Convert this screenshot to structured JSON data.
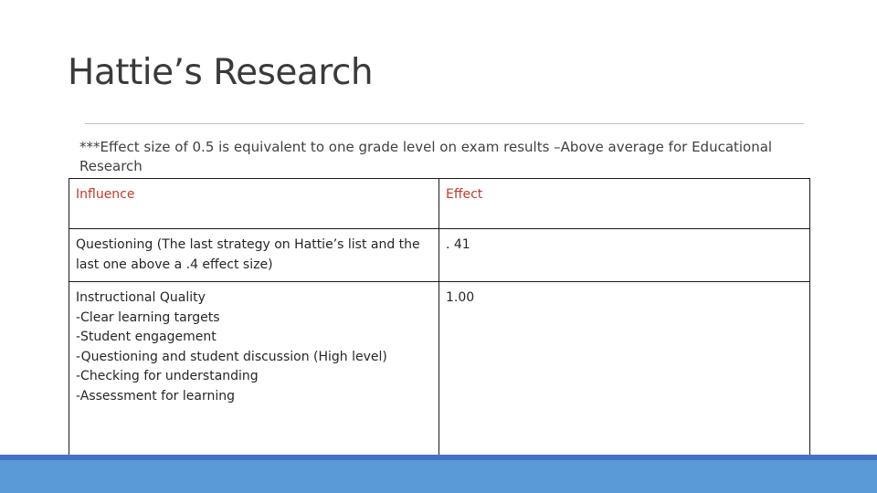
{
  "slide": {
    "title": "Hattie’s Research",
    "note": "***Effect size of 0.5 is equivalent to one grade level on exam results –Above average for Educational Research"
  },
  "table": {
    "headers": [
      "Influence",
      "Effect"
    ],
    "rows": [
      {
        "influence": "Questioning (The last strategy on Hattie’s list and the last one above a .4 effect size)",
        "effect": ". 41"
      },
      {
        "influence": "Instructional Quality\n-Clear learning targets\n-Student engagement\n-Questioning and student discussion (High level)\n-Checking for understanding\n-Assessment for learning",
        "effect": "1.00"
      }
    ]
  },
  "colors": {
    "header_text": "#c0392b",
    "footer_bar": "#5b9bd5",
    "footer_stripe": "#4472c4"
  }
}
